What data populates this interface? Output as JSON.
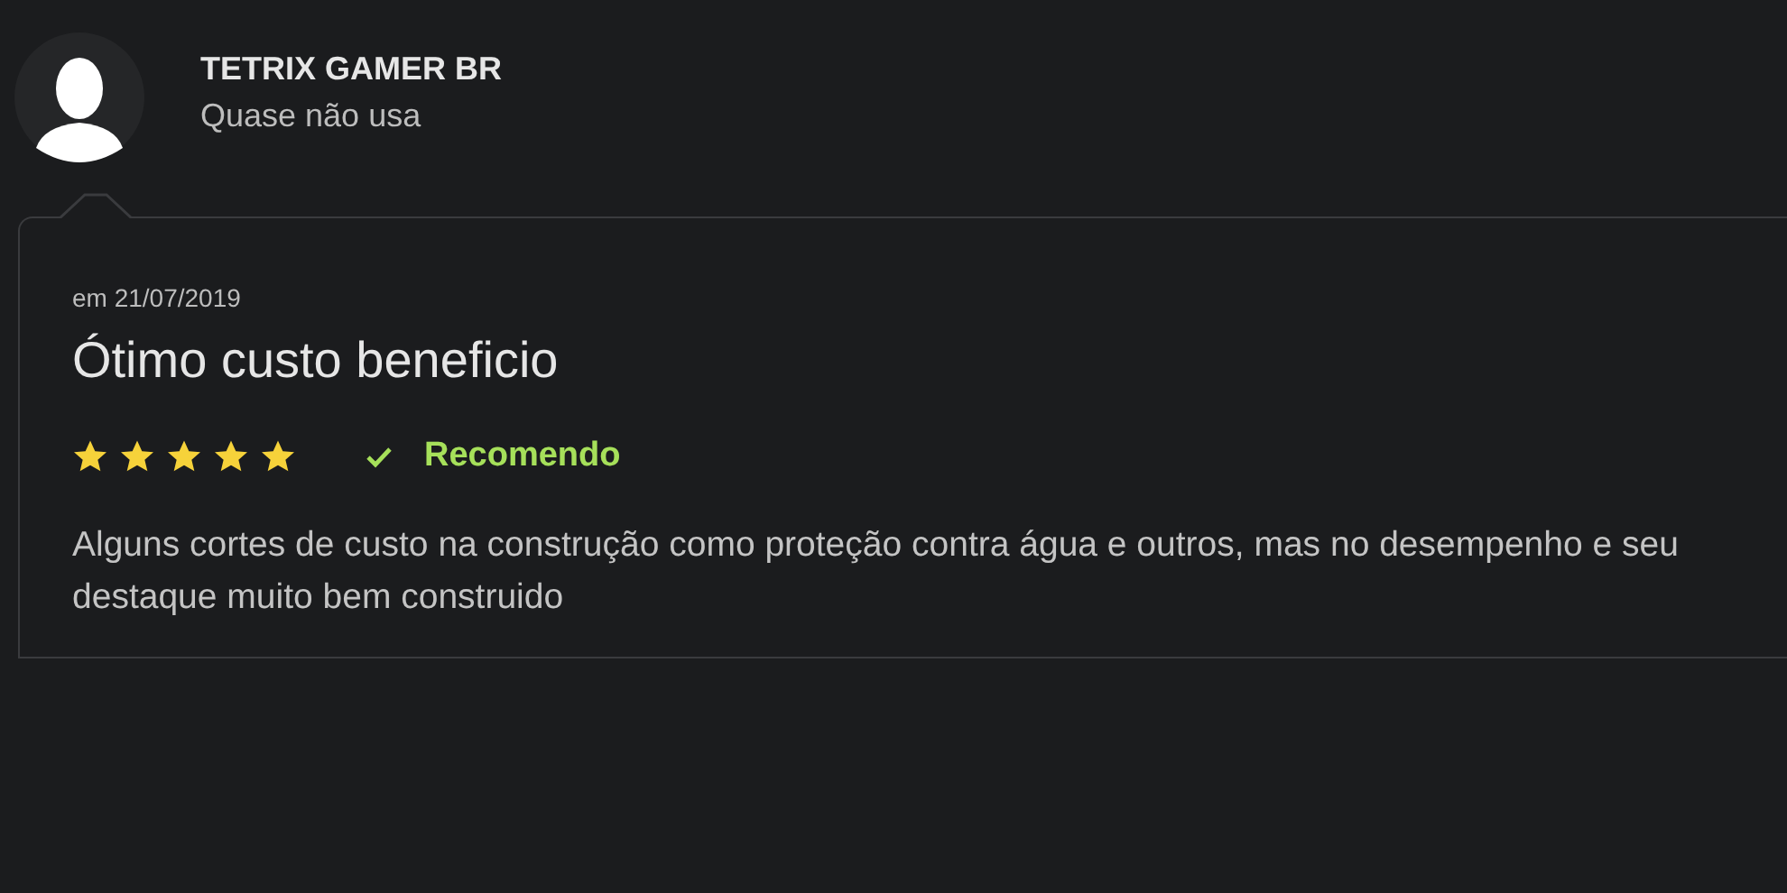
{
  "user": {
    "name": "TETRIX GAMER BR",
    "usage": "Quase não usa"
  },
  "review": {
    "date": "em 21/07/2019",
    "title": "Ótimo custo beneficio",
    "stars": 5,
    "recommended": true,
    "recommend_label": "Recomendo",
    "body": "Alguns cortes de custo na construção como proteção contra água e outros, mas no desempenho e seu destaque muito bem construido"
  }
}
